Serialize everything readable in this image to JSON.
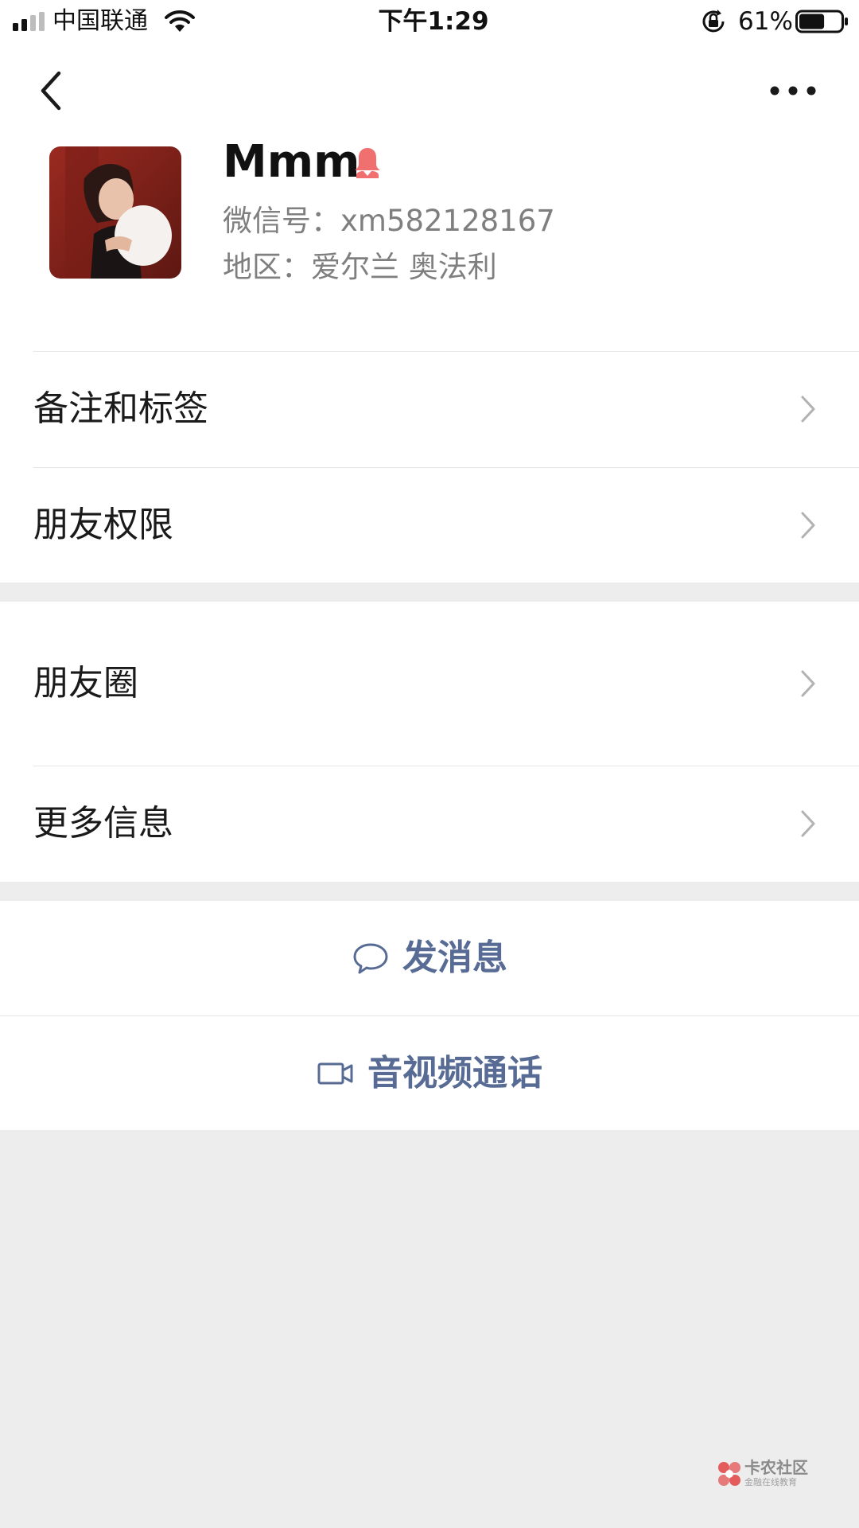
{
  "status_bar": {
    "carrier": "中国联通",
    "time": "下午1:29",
    "battery_percent": "61%",
    "battery_level": 0.61
  },
  "header": {
    "back_icon": "chevron-left-icon",
    "more_icon": "ellipsis-icon"
  },
  "profile": {
    "name": "Mmm",
    "gender_icon": "female-icon",
    "gender_color": "#fa5151",
    "wechat_id_label": "微信号：",
    "wechat_id": "xm582128167",
    "region_label": "地区：",
    "region": "爱尔兰 奥法利"
  },
  "menu": {
    "remarks_tags": "备注和标签",
    "friend_permissions": "朋友权限",
    "moments": "朋友圈",
    "more_info": "更多信息"
  },
  "actions": {
    "send_message": "发消息",
    "video_call": "音视频通话",
    "link_color": "#576b95"
  },
  "watermark": {
    "title": "卡农社区",
    "subtitle": "金融在线教育"
  }
}
